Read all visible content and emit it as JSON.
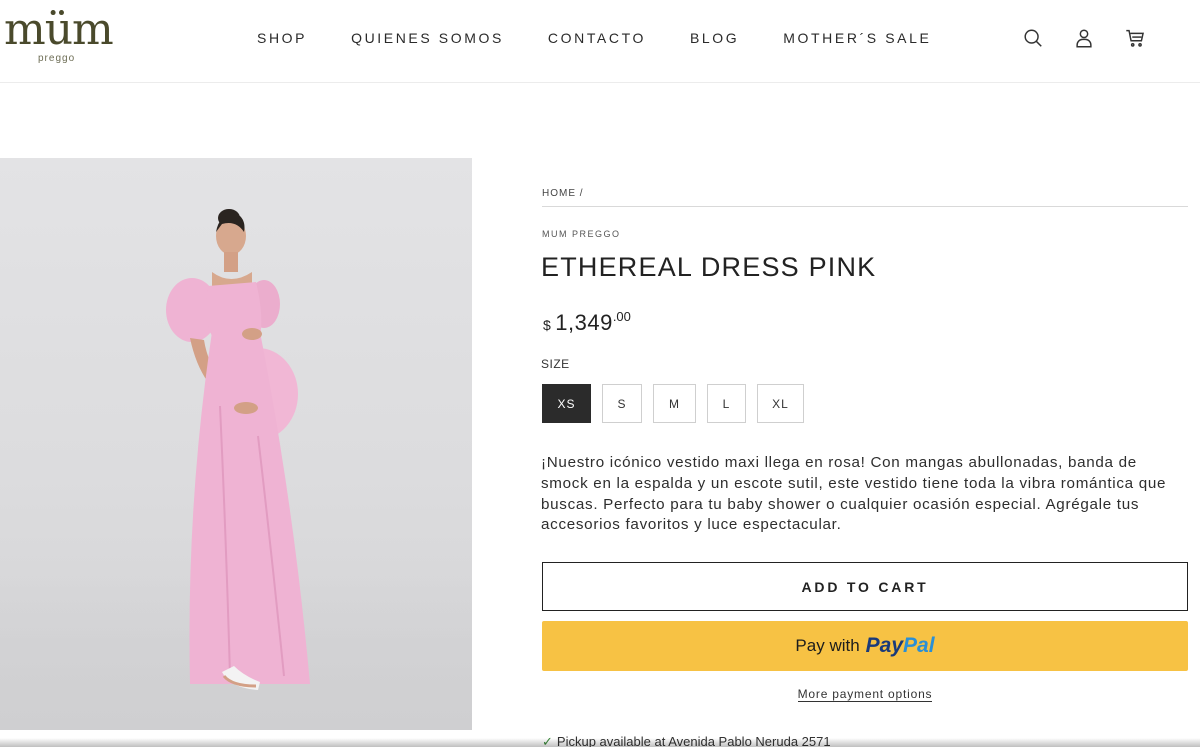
{
  "brand": {
    "name": "müm",
    "sub": "preggo"
  },
  "nav": [
    "SHOP",
    "QUIENES SOMOS",
    "CONTACTO",
    "BLOG",
    "MOTHER´S SALE"
  ],
  "header_icons": [
    "search-icon",
    "account-icon",
    "cart-icon"
  ],
  "breadcrumb": "HOME /",
  "product": {
    "vendor": "MUM PREGGO",
    "title": "ETHEREAL DRESS PINK",
    "price": {
      "currency": "$",
      "main": "1,349",
      "cents": ".00"
    },
    "size_label": "SIZE",
    "sizes": [
      "XS",
      "S",
      "M",
      "L",
      "XL"
    ],
    "selected_size": "XS",
    "description": "¡Nuestro icónico vestido maxi llega en rosa! Con mangas abullonadas, banda de smock en la espalda y un escote sutil, este vestido tiene toda la vibra romántica que buscas. Perfecto para tu baby shower o cualquier ocasión especial. Agrégale tus accesorios favoritos y luce espectacular.",
    "add_to_cart": "ADD TO CART",
    "paypal": {
      "prefix": "Pay with",
      "brand_a": "Pay",
      "brand_b": "Pal"
    },
    "more_payment": "More payment options",
    "pickup": "Pickup available at Avenida Pablo Neruda 2571"
  },
  "colors": {
    "accent_paypal": "#f7c244",
    "dress": "#efb3d3",
    "selected_size_bg": "#2b2b2b"
  }
}
